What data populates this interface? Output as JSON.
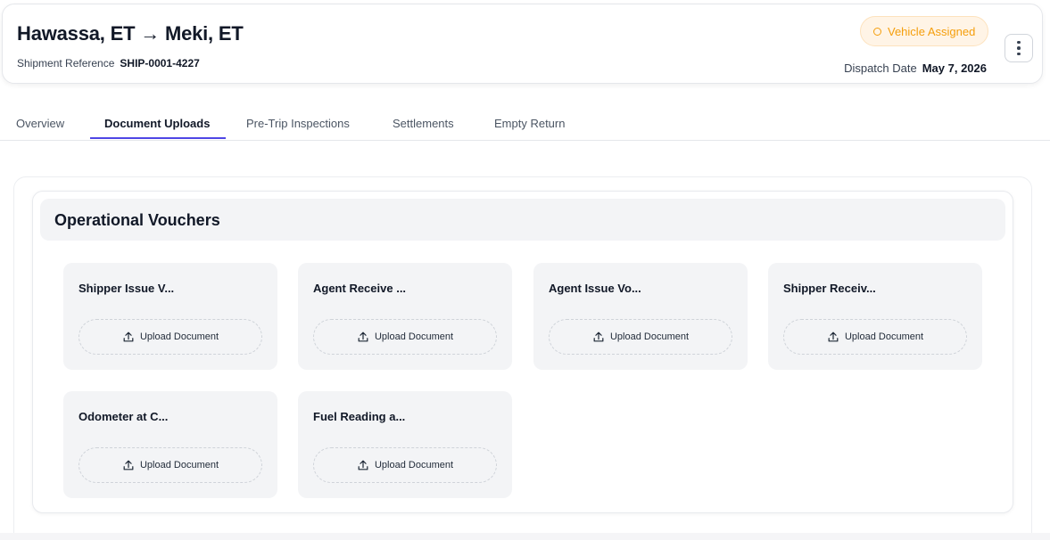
{
  "header": {
    "route_title": "Hawassa, ET → Meki, ET",
    "reference_label": "Shipment Reference",
    "reference_value": "SHIP-0001-4227",
    "status": "Vehicle Assigned",
    "dispatch_label": "Dispatch Date",
    "dispatch_value": "May 7, 2026",
    "menu_icon": "vertical-dots-icon"
  },
  "tabs": [
    {
      "label": "Overview",
      "active": false
    },
    {
      "label": "Document Uploads",
      "active": true
    },
    {
      "label": "Pre-Trip Inspections",
      "active": false
    },
    {
      "label": "Settlements",
      "active": false
    },
    {
      "label": "Empty Return",
      "active": false
    }
  ],
  "section": {
    "title": "Operational Vouchers",
    "documents": [
      {
        "title": "Shipper Issue V...",
        "button": "Upload Document"
      },
      {
        "title": "Agent Receive ...",
        "button": "Upload Document"
      },
      {
        "title": "Agent Issue Vo...",
        "button": "Upload Document"
      },
      {
        "title": "Shipper Receiv...",
        "button": "Upload Document"
      },
      {
        "title": "Odometer at C...",
        "button": "Upload Document"
      },
      {
        "title": "Fuel Reading a...",
        "button": "Upload Document"
      }
    ]
  },
  "colors": {
    "accent": "#4f46e5",
    "status_text": "#f59e0b",
    "status_bg": "#fff4e6",
    "card_bg": "#f3f4f6"
  }
}
